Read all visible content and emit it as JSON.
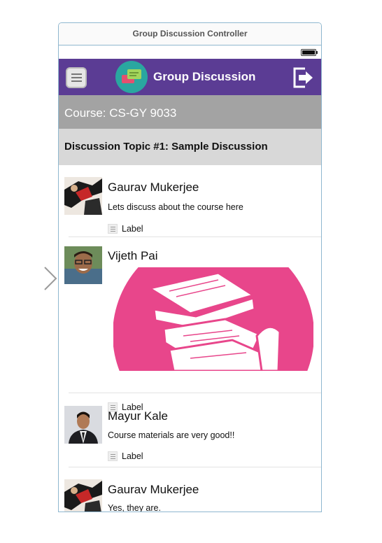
{
  "storyboard": {
    "scene_title": "Group Discussion Controller"
  },
  "navbar": {
    "title": "Group Discussion"
  },
  "course": {
    "label": "Course: CS-GY 9033"
  },
  "topic": {
    "label": "Discussion Topic #1: Sample Discussion"
  },
  "posts": [
    {
      "author": "Gaurav Mukerjee",
      "message": "Lets discuss about the course here",
      "label": "Label"
    },
    {
      "author": "Vijeth Pai",
      "message": "",
      "label": "Label"
    },
    {
      "author": "Mayur Kale",
      "message": "Course materials are very good!!",
      "label": "Label"
    },
    {
      "author": "Gaurav Mukerjee",
      "message": "Yes, they are.",
      "label": ""
    }
  ],
  "colors": {
    "navbar": "#5b3c94",
    "course_bar": "#a3a3a3",
    "topic_bar": "#d8d8d8",
    "image_pink": "#e8468b"
  },
  "icons": {
    "menu": "hamburger-icon",
    "logo": "chat-bubbles-icon",
    "logout": "logout-icon"
  }
}
